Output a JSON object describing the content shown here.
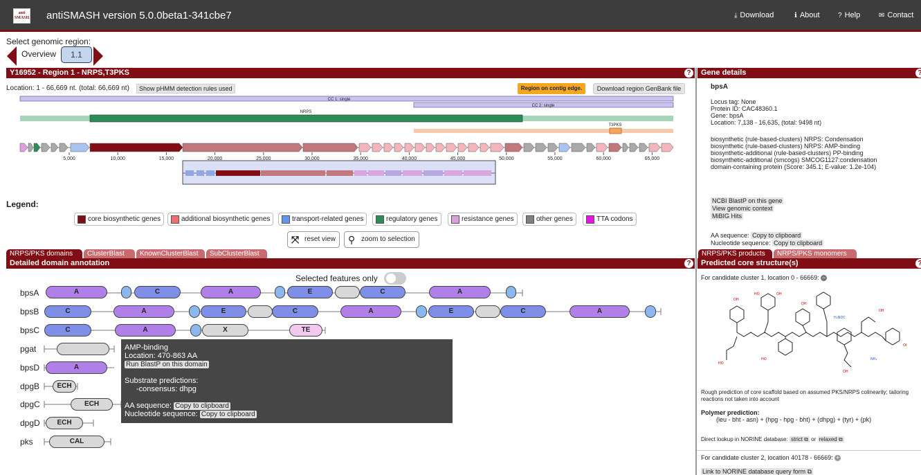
{
  "app": {
    "logo_top": "anti",
    "logo_bottom": "SMASH",
    "title": "antiSMASH version 5.0.0beta1-341cbe7"
  },
  "nav": [
    {
      "icon": "download-icon",
      "glyph": "⤓",
      "label": "Download"
    },
    {
      "icon": "info-icon",
      "glyph": "ℹ",
      "label": "About"
    },
    {
      "icon": "help-icon",
      "glyph": "?",
      "label": "Help"
    },
    {
      "icon": "mail-icon",
      "glyph": "✉",
      "label": "Contact"
    }
  ],
  "region_select": {
    "label": "Select genomic region:",
    "overview": "Overview",
    "region_button": "1.1"
  },
  "region_panel": {
    "title": "Y16952 - Region 1 - NRPS,T3PKS",
    "location": "Location: 1 - 66,669 nt. (total: 66,669 nt)",
    "show_rules": "Show pHMM detection rules used",
    "edge_badge": "Region on contig edge.",
    "download_genbank": "Download region GenBank file",
    "cc1": "CC 1: single",
    "cc2": "CC 2: single",
    "proto1": "NRPS",
    "proto2": "T3PKS",
    "ticks": [
      "5,000",
      "10,000",
      "15,000",
      "20,000",
      "25,000",
      "30,000",
      "35,000",
      "40,000",
      "45,000",
      "50,000",
      "55,000",
      "60,000",
      "65,000"
    ]
  },
  "legend": {
    "title": "Legend:",
    "items": [
      {
        "label": "core biosynthetic genes",
        "color": "#810e15"
      },
      {
        "label": "additional biosynthetic genes",
        "color": "#f16d75"
      },
      {
        "label": "transport-related genes",
        "color": "#6495ed"
      },
      {
        "label": "regulatory genes",
        "color": "#2e8b57"
      },
      {
        "label": "resistance genes",
        "color": "#dda0dd"
      },
      {
        "label": "other genes",
        "color": "#808080"
      },
      {
        "label": "TTA codons",
        "color": "#e316e6"
      }
    ],
    "reset_view": "reset view",
    "zoom": "zoom to selection"
  },
  "tabs_left": [
    "NRPS/PKS domains",
    "ClusterBlast",
    "KnownClusterBlast",
    "SubClusterBlast"
  ],
  "domain_panel": {
    "title": "Detailed domain annotation",
    "selected_only": "Selected features only",
    "genes": [
      "bpsA",
      "bpsB",
      "bpsC",
      "pgat",
      "bpsD",
      "dpgB",
      "dpgC",
      "dpgD",
      "pks"
    ],
    "domain_labels": {
      "bpsA": [
        "A",
        "C",
        "A",
        "E",
        "C",
        "A"
      ],
      "bpsB": [
        "C",
        "A",
        "E",
        "C",
        "A",
        "E",
        "C",
        "A"
      ],
      "bpsC": [
        "C",
        "A",
        "X",
        "TE"
      ],
      "bpsD": [
        "A"
      ],
      "dpgB": [
        "ECH"
      ],
      "dpgC": [
        "ECH"
      ],
      "dpgD": [
        "ECH"
      ],
      "pks": [
        "CAL"
      ]
    }
  },
  "tooltip": {
    "name": "AMP-binding",
    "location": "Location: 470-863 AA",
    "blast": "Run BlastP on this domain",
    "substrate_title": "Substrate predictions:",
    "consensus": "-consensus: dhpg",
    "aa_label": "AA sequence:",
    "nt_label": "Nucleotide sequence:",
    "copy": "Copy to clipboard"
  },
  "gene_details": {
    "title": "Gene details",
    "name": "bpsA",
    "locus_tag": "Locus tag: None",
    "protein_id": "Protein ID: CAC48360.1",
    "gene": "Gene: bpsA",
    "location": "Location: 7,138 - 16,635, (total: 9498 nt)",
    "annotations": [
      "biosynthetic (rule-based-clusters) NRPS: Condensation",
      "biosynthetic (rule-based-clusters) NRPS: AMP-binding",
      "biosynthetic-additional (rule-based-clusters) PP-binding",
      "biosynthetic-additional (smcogs) SMCOG1127:condensation",
      "domain-containing protein (Score: 345.1; E-value: 1.2e-104)"
    ],
    "links": [
      "NCBI BlastP on this gene",
      "View genomic context",
      "MiBIG Hits"
    ],
    "aa_label": "AA sequence:",
    "nt_label": "Nucleotide sequence:",
    "copy": "Copy to clipboard"
  },
  "tabs_right": [
    "NRPS/PKS products",
    "NRPS/PKS monomers"
  ],
  "structure": {
    "title": "Predicted core structure(s)",
    "candidate1": "For candidate cluster 1, location 0 - 66669:",
    "caveat": "Rough prediction of core scaffold based on assumed PKS/NRPS colinearity; tailoring reactions not taken into account",
    "polymer_title": "Polymer prediction:",
    "polymer": "(leu - bht - asn) + (hpg - hpg - bht) + (dhpg) + (tyr) + (pk)",
    "norine_label": "Direct lookup in NORINE database:",
    "strict": "strict",
    "or": "or",
    "relaxed": "relaxed",
    "candidate2": "For candidate cluster 2, location 40178 - 66669:",
    "norine_link": "Link to NORINE database query form"
  }
}
